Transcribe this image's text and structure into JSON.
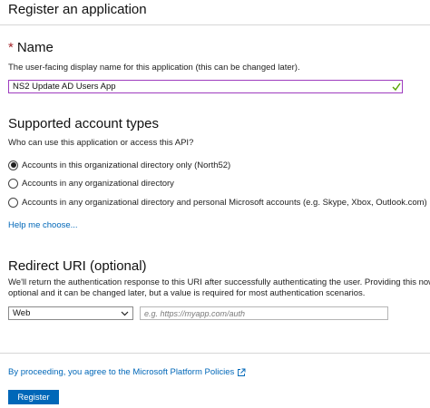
{
  "page": {
    "title": "Register an application"
  },
  "name_section": {
    "required_marker": "*",
    "heading": "Name",
    "helper": "The user-facing display name for this application (this can be changed later).",
    "value": "NS2 Update AD Users App"
  },
  "account_types": {
    "heading": "Supported account types",
    "question": "Who can use this application or access this API?",
    "options": [
      {
        "label": "Accounts in this organizational directory only (North52)",
        "selected": true
      },
      {
        "label": "Accounts in any organizational directory",
        "selected": false
      },
      {
        "label": "Accounts in any organizational directory and personal Microsoft accounts (e.g. Skype, Xbox, Outlook.com)",
        "selected": false
      }
    ],
    "help_link": "Help me choose..."
  },
  "redirect": {
    "heading": "Redirect URI (optional)",
    "description_line1": "We'll return the authentication response to this URI after successfully authenticating the user. Providing this now is",
    "description_line2": "optional and it can be changed later, but a value is required for most authentication scenarios.",
    "platform_selected": "Web",
    "uri_placeholder": "e.g. https://myapp.com/auth",
    "uri_value": ""
  },
  "footer": {
    "policy_text": "By proceeding, you agree to the Microsoft Platform Policies",
    "register_label": "Register"
  },
  "colors": {
    "accent": "#0067b8",
    "input_focus_border": "#9e3dbf",
    "valid_check": "#57a300",
    "required": "#a4262c"
  },
  "icons": {
    "valid": "check-icon",
    "dropdown": "chevron-down-icon",
    "external": "external-link-icon"
  }
}
